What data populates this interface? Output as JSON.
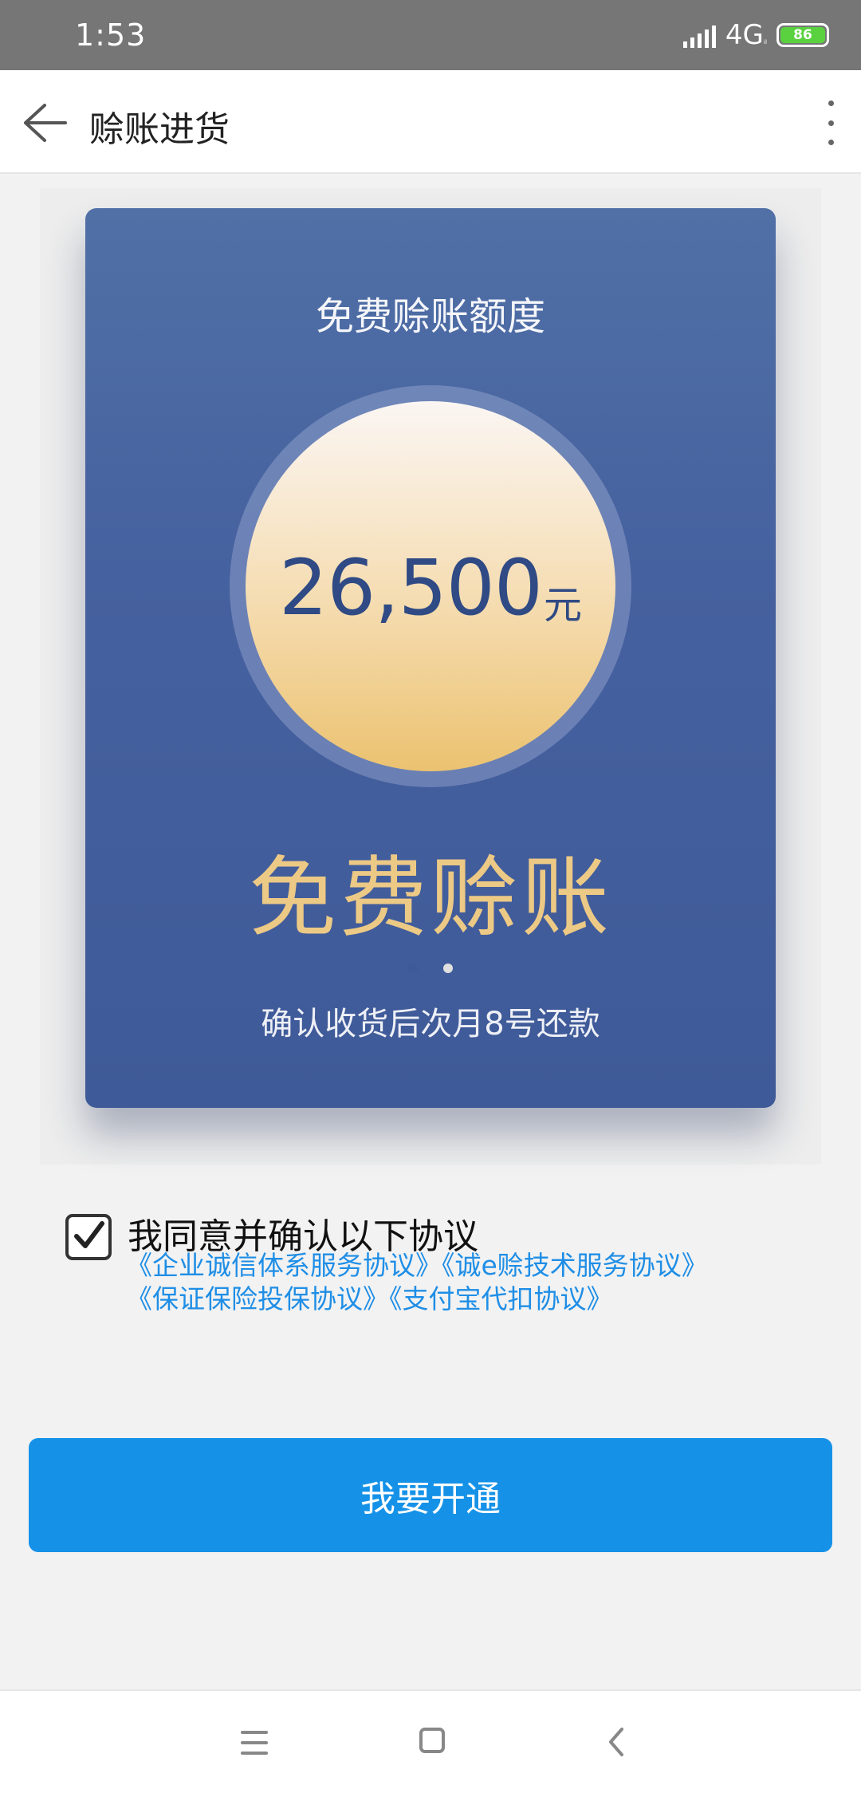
{
  "status_bar": {
    "time": "1:53",
    "network": "4G",
    "network_sub": "ᵢₗ",
    "battery": "86"
  },
  "header": {
    "title": "赊账进货"
  },
  "card": {
    "title": "免费赊账额度",
    "amount": "26,500",
    "unit": "元",
    "slogan": "免费赊账",
    "note": "确认收货后次月8号还款"
  },
  "carousel": {
    "active_index": 0,
    "count": 2
  },
  "agreement": {
    "checked": true,
    "label": "我同意并确认以下协议",
    "links_line1": "《企业诚信体系服务协议》《诚e赊技术服务协议》",
    "links_line2": "《保证保险投保协议》《支付宝代扣协议》"
  },
  "action": {
    "label": "我要开通"
  },
  "colors": {
    "card": "#46619f",
    "button": "#1592e8",
    "link": "#1f8ee6",
    "gold": "#ecc985"
  }
}
